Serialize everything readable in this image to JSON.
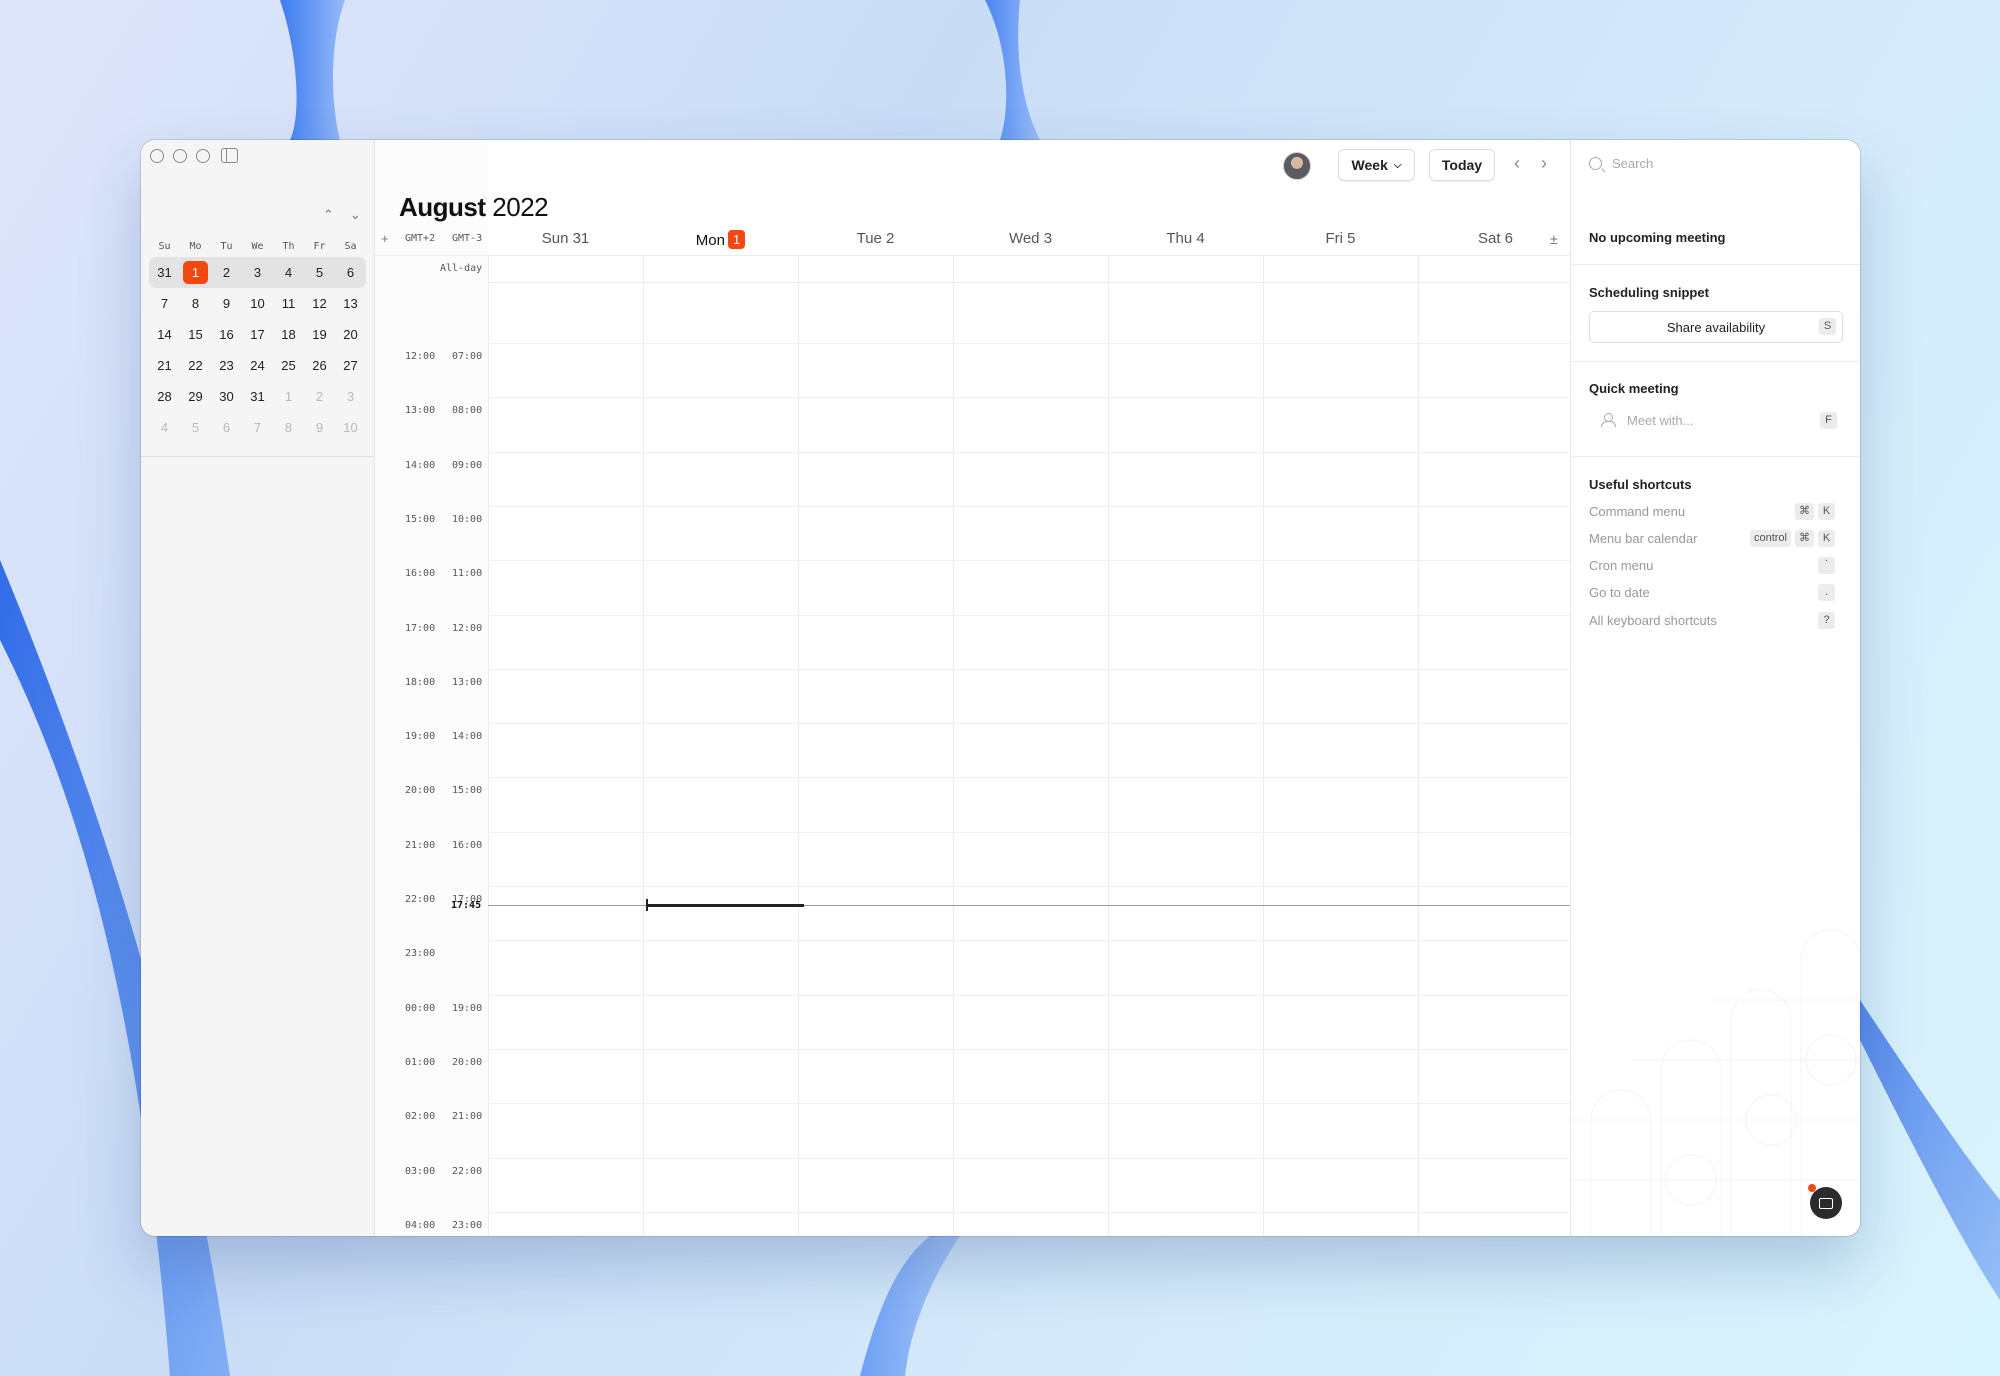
{
  "mini_calendar": {
    "weekdays": [
      "Su",
      "Mo",
      "Tu",
      "We",
      "Th",
      "Fr",
      "Sa"
    ],
    "weeks": [
      [
        "31",
        "1",
        "2",
        "3",
        "4",
        "5",
        "6"
      ],
      [
        "7",
        "8",
        "9",
        "10",
        "11",
        "12",
        "13"
      ],
      [
        "14",
        "15",
        "16",
        "17",
        "18",
        "19",
        "20"
      ],
      [
        "21",
        "22",
        "23",
        "24",
        "25",
        "26",
        "27"
      ],
      [
        "28",
        "29",
        "30",
        "31",
        "1",
        "2",
        "3"
      ],
      [
        "4",
        "5",
        "6",
        "7",
        "8",
        "9",
        "10"
      ]
    ],
    "prev_icon": "chevron-up-icon",
    "next_icon": "chevron-down-icon"
  },
  "toolbar": {
    "view_label": "Week",
    "today_label": "Today",
    "prev_icon": "chevron-left-icon",
    "next_icon": "chevron-right-icon"
  },
  "header": {
    "month": "August",
    "year": "2022",
    "add_label": "+",
    "tz_primary": "GMT+2",
    "tz_secondary": "GMT-3",
    "allday_label": "All-day",
    "plusminus": "±"
  },
  "days": [
    {
      "label": "Sun 31"
    },
    {
      "label": "Mon",
      "badge": "1",
      "current": true
    },
    {
      "label": "Tue 2"
    },
    {
      "label": "Wed 3"
    },
    {
      "label": "Thu 4"
    },
    {
      "label": "Fri 5"
    },
    {
      "label": "Sat 6"
    }
  ],
  "time_rows": [
    {
      "primary": "12:00",
      "secondary": "07:00"
    },
    {
      "primary": "13:00",
      "secondary": "08:00"
    },
    {
      "primary": "14:00",
      "secondary": "09:00"
    },
    {
      "primary": "15:00",
      "secondary": "10:00"
    },
    {
      "primary": "16:00",
      "secondary": "11:00"
    },
    {
      "primary": "17:00",
      "secondary": "12:00"
    },
    {
      "primary": "18:00",
      "secondary": "13:00"
    },
    {
      "primary": "19:00",
      "secondary": "14:00"
    },
    {
      "primary": "20:00",
      "secondary": "15:00"
    },
    {
      "primary": "21:00",
      "secondary": "16:00"
    },
    {
      "primary": "22:00",
      "secondary": "17:00"
    },
    {
      "primary": "23:00",
      "secondary": ""
    },
    {
      "primary": "00:00",
      "secondary": "19:00"
    },
    {
      "primary": "01:00",
      "secondary": "20:00"
    },
    {
      "primary": "02:00",
      "secondary": "21:00"
    },
    {
      "primary": "03:00",
      "secondary": "22:00"
    },
    {
      "primary": "04:00",
      "secondary": "23:00"
    }
  ],
  "now_label": "17:45",
  "right_panel": {
    "search_placeholder": "Search",
    "upcoming": "No upcoming meeting",
    "snippet_title": "Scheduling snippet",
    "share_label": "Share availability",
    "share_key": "S",
    "quick_title": "Quick meeting",
    "meet_placeholder": "Meet with...",
    "meet_key": "F",
    "shortcuts_title": "Useful shortcuts",
    "shortcuts": [
      {
        "label": "Command menu",
        "keys": [
          "⌘",
          "K"
        ]
      },
      {
        "label": "Menu bar calendar",
        "keys": [
          "control",
          "⌘",
          "K"
        ]
      },
      {
        "label": "Cron menu",
        "keys": [
          "`"
        ]
      },
      {
        "label": "Go to date",
        "keys": [
          "."
        ]
      },
      {
        "label": "All keyboard shortcuts",
        "keys": [
          "?"
        ]
      }
    ]
  },
  "colors": {
    "accent": "#f2470f",
    "background_gradient": [
      "#dfe6fb",
      "#d8f4fd"
    ]
  }
}
